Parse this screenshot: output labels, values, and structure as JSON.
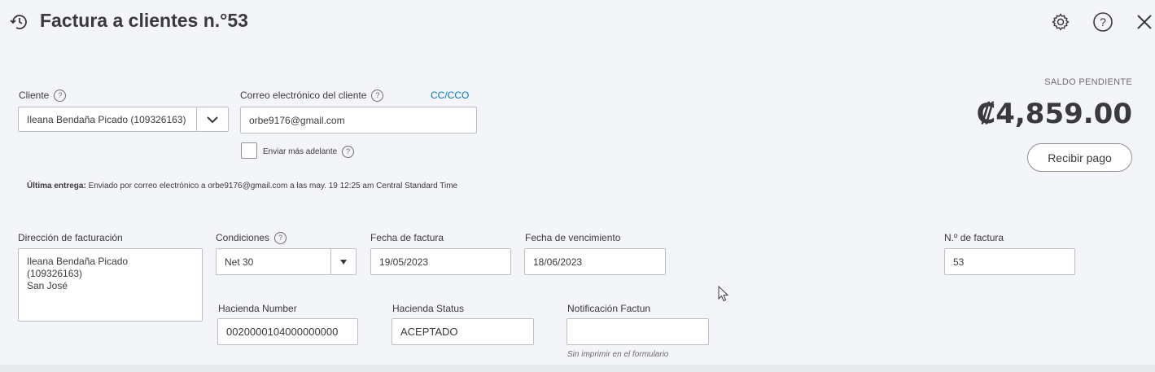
{
  "header": {
    "title": "Factura a clientes n.°53"
  },
  "customer": {
    "label": "Cliente",
    "value": "Ileana Bendaña Picado (109326163)"
  },
  "email": {
    "label": "Correo electrónico del cliente",
    "cc_link": "CC/CCO",
    "value": "orbe9176@gmail.com",
    "send_later_label": "Enviar más adelante"
  },
  "last_delivery": {
    "label": "Última entrega:",
    "text": "Enviado por correo electrónico a orbe9176@gmail.com a las may. 19 12:25 am Central Standard Time"
  },
  "balance": {
    "label": "SALDO PENDIENTE",
    "amount": "₡4,859.00",
    "receive_payment_label": "Recibir pago"
  },
  "billing_address": {
    "label": "Dirección de facturación",
    "value": "Ileana Bendaña Picado\n(109326163)\nSan José"
  },
  "terms": {
    "label": "Condiciones",
    "value": "Net 30"
  },
  "invoice_date": {
    "label": "Fecha de factura",
    "value": "19/05/2023"
  },
  "due_date": {
    "label": "Fecha de vencimiento",
    "value": "18/06/2023"
  },
  "invoice_number": {
    "label": "N.º de factura",
    "value": "53"
  },
  "hacienda_number": {
    "label": "Hacienda Number",
    "value": "0020000104000000000"
  },
  "hacienda_status": {
    "label": "Hacienda Status",
    "value": "ACEPTADO"
  },
  "notification": {
    "label": "Notificación Factun",
    "value": "",
    "note": "Sin imprimir en el formulario"
  },
  "icons": {
    "history": "history-clock-icon",
    "settings": "gear-icon",
    "help": "help-icon",
    "close": "close-icon"
  },
  "colors": {
    "accent_link": "#0077c5",
    "background": "#f4f5f8"
  }
}
